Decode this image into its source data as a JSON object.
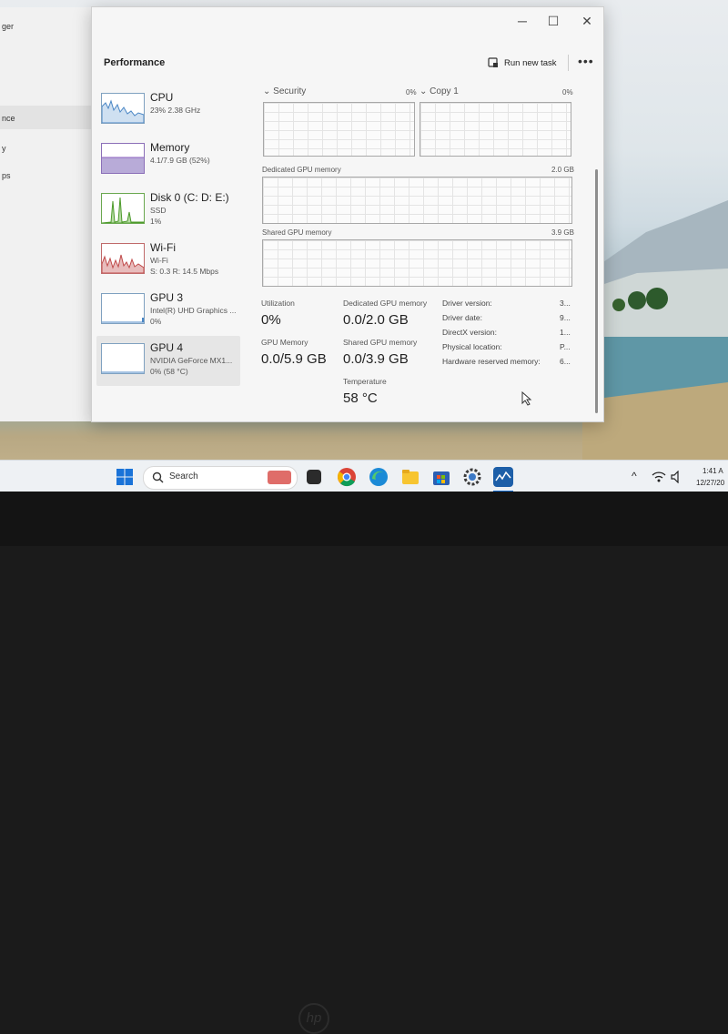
{
  "back_window": {
    "labels": [
      "ger",
      "nce",
      "y",
      "ps"
    ]
  },
  "window": {
    "controls": {
      "minimize": "─",
      "maximize": "☐",
      "close": "✕"
    }
  },
  "header": {
    "title": "Performance",
    "run_task_label": "Run new task",
    "more_label": "•••"
  },
  "devices": [
    {
      "name": "CPU",
      "line1": "23% 2.38 GHz",
      "line2": ""
    },
    {
      "name": "Memory",
      "line1": "4.1/7.9 GB (52%)",
      "line2": ""
    },
    {
      "name": "Disk 0 (C: D: E:)",
      "line1": "SSD",
      "line2": "1%"
    },
    {
      "name": "Wi-Fi",
      "line1": "Wi-Fi",
      "line2": "S: 0.3  R: 14.5 Mbps"
    },
    {
      "name": "GPU 3",
      "line1": "Intel(R) UHD Graphics ...",
      "line2": "0%"
    },
    {
      "name": "GPU 4",
      "line1": "NVIDIA GeForce MX1...",
      "line2": "0% (58 °C)"
    }
  ],
  "engines": [
    {
      "name": "Security",
      "percent": "0%"
    },
    {
      "name": "Copy 1",
      "percent": "0%"
    }
  ],
  "dedicated_graph": {
    "label": "Dedicated GPU memory",
    "max": "2.0 GB"
  },
  "shared_graph": {
    "label": "Shared GPU memory",
    "max": "3.9 GB"
  },
  "stats": {
    "utilization": {
      "label": "Utilization",
      "value": "0%"
    },
    "dedicated": {
      "label": "Dedicated GPU memory",
      "value": "0.0/2.0 GB"
    },
    "gpu_memory": {
      "label": "GPU Memory",
      "value": "0.0/5.9 GB"
    },
    "shared": {
      "label": "Shared GPU memory",
      "value": "0.0/3.9 GB"
    },
    "temperature": {
      "label": "Temperature",
      "value": "58 °C"
    }
  },
  "info": [
    {
      "key": "Driver version:",
      "value": "3..."
    },
    {
      "key": "Driver date:",
      "value": "9..."
    },
    {
      "key": "DirectX version:",
      "value": "1..."
    },
    {
      "key": "Physical location:",
      "value": "P..."
    },
    {
      "key": "Hardware reserved memory:",
      "value": "6..."
    }
  ],
  "taskbar": {
    "search_label": "Search",
    "clock_time": "1:41 A",
    "clock_date": "12/27/20"
  },
  "colors": {
    "window_bg": "#f6f6f6",
    "cpu_graph": "#4a86c5",
    "memory_graph": "#8b5fbf",
    "disk_graph": "#4c9a2a",
    "wifi_graph": "#c04a4a",
    "taskbar_bg": "#eef1f4"
  },
  "icons": {
    "run_task": "run-task-icon",
    "more": "more-options-icon",
    "expand": "chevron-down-icon",
    "start": "windows-start-icon",
    "search": "search-icon",
    "wifi": "wifi-icon",
    "volume": "volume-icon",
    "chevron_up": "chevron-up-icon"
  },
  "hp_logo": "hp"
}
